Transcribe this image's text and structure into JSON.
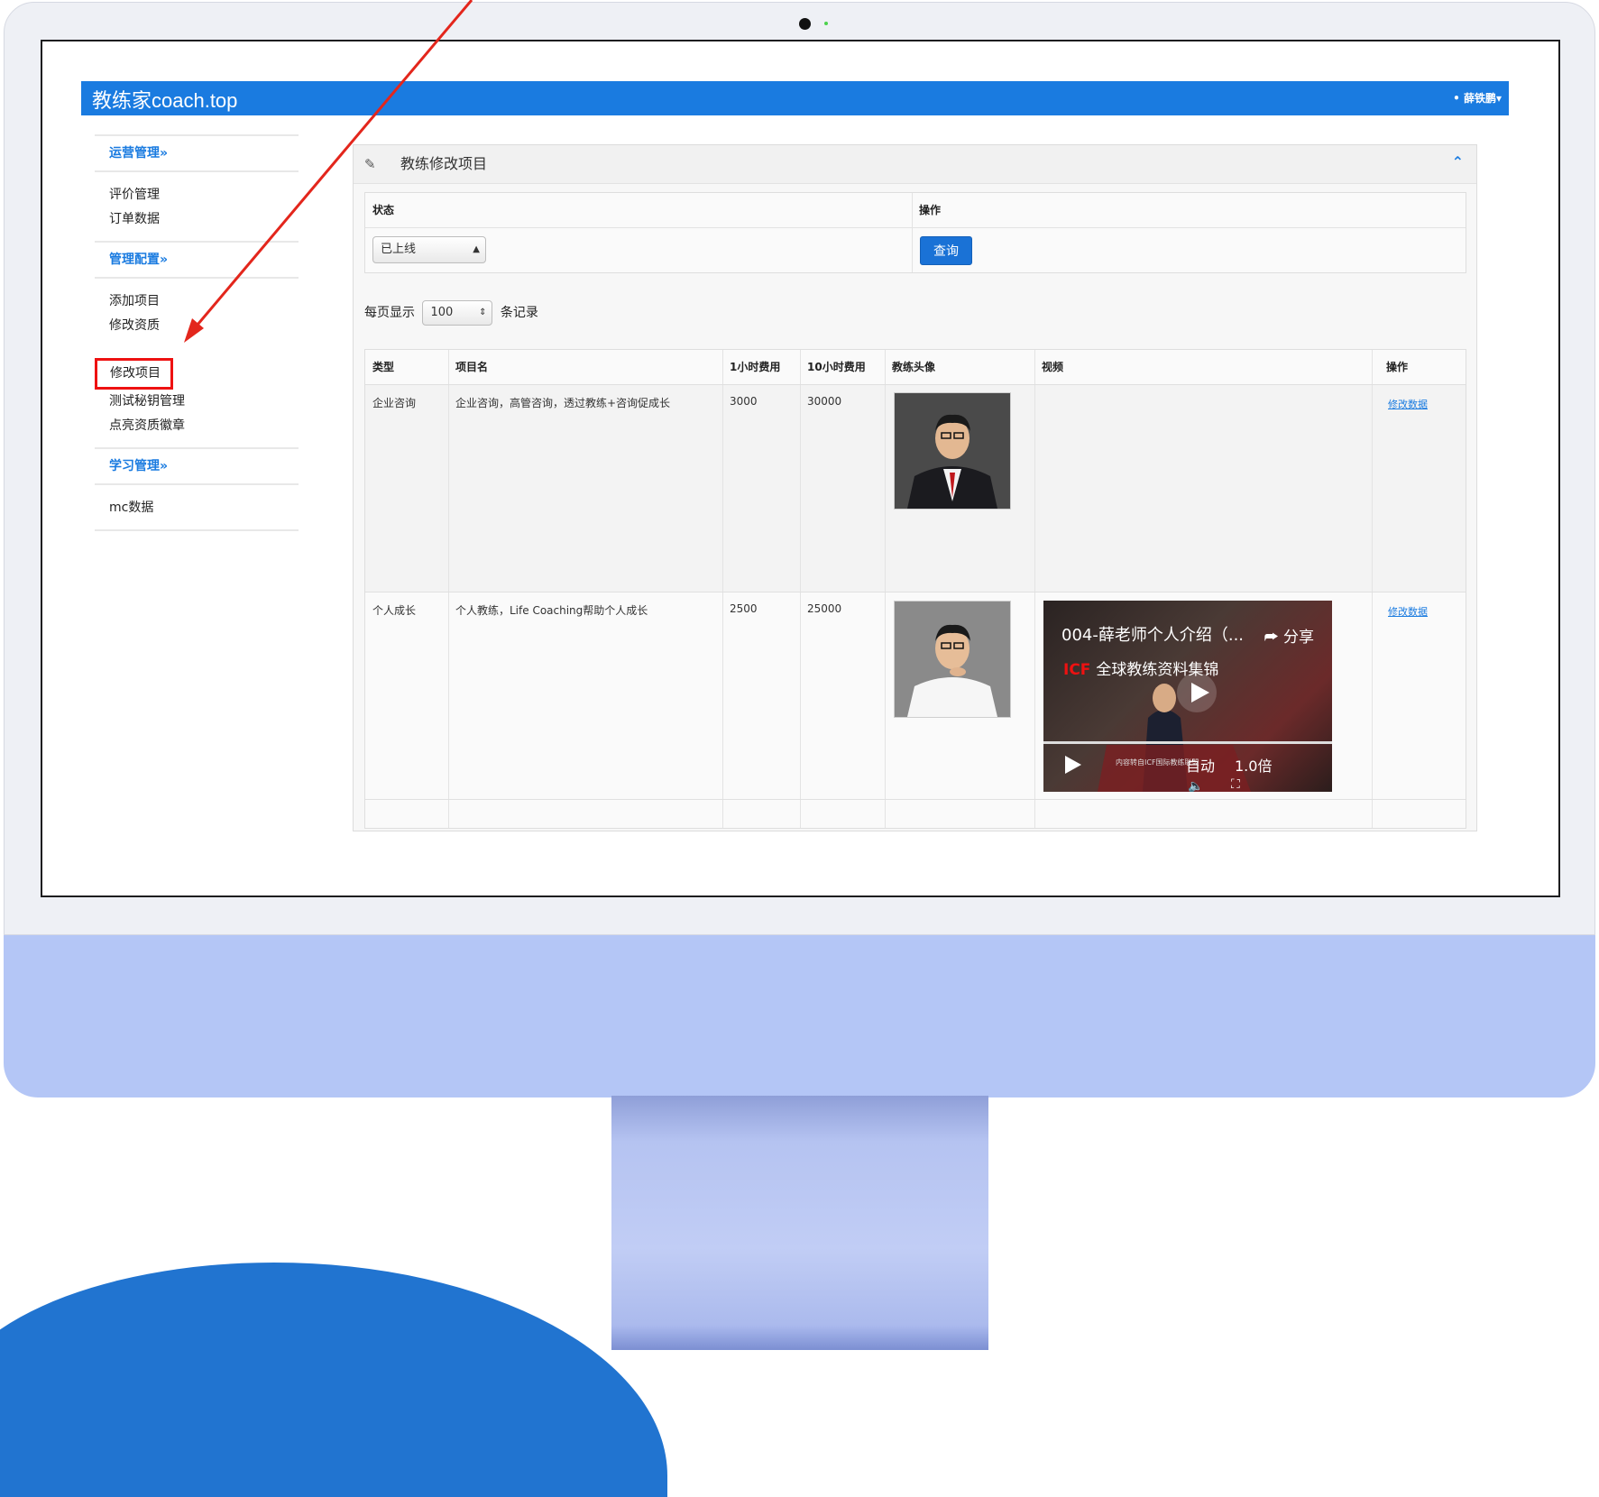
{
  "app": {
    "brand": "教练家coach.top",
    "user": "• 薛铁鹏▾"
  },
  "sidebar": {
    "groups": [
      {
        "title": "运营管理»",
        "items": [
          "评价管理",
          "订单数据"
        ]
      },
      {
        "title": "管理配置»",
        "items": [
          "添加项目",
          "修改资质",
          "修改项目",
          "测试秘钥管理",
          "点亮资质徽章"
        ]
      },
      {
        "title": "学习管理»",
        "items": [
          "mc数据"
        ]
      }
    ],
    "highlighted": "修改项目"
  },
  "panel": {
    "title": "教练修改项目",
    "filter": {
      "status_label": "状态",
      "status_value": "已上线",
      "action_label": "操作",
      "query_button": "查询"
    },
    "page_size": {
      "prefix": "每页显示",
      "value": "100",
      "suffix": "条记录"
    },
    "table": {
      "headers": [
        "类型",
        "项目名",
        "1小时费用",
        "10小时费用",
        "教练头像",
        "视频",
        "操作"
      ],
      "rows": [
        {
          "type": "企业咨询",
          "name": "企业咨询，高管咨询，透过教练+咨询促成长",
          "fee1": "3000",
          "fee10": "30000",
          "video": "",
          "action": "修改数据"
        },
        {
          "type": "个人成长",
          "name": "个人教练，Life Coaching帮助个人成长",
          "fee1": "2500",
          "fee10": "25000",
          "action": "修改数据"
        }
      ]
    },
    "video": {
      "title": "004-薛老师个人介绍（...",
      "share": "分享",
      "icf_badge": "ICF",
      "channel": "全球教练资料集锦",
      "small_text": "内容转自ICF国际教练联盟",
      "auto": "自动",
      "speed": "1.0倍"
    }
  },
  "colors": {
    "brand_blue": "#1a7be0",
    "highlight_red": "#e11111",
    "imac_chin": "#b4c6f6"
  },
  "icons": {
    "edit": "edit-icon",
    "collapse": "chevron-up-icon",
    "share": "share-icon",
    "play": "play-icon"
  }
}
